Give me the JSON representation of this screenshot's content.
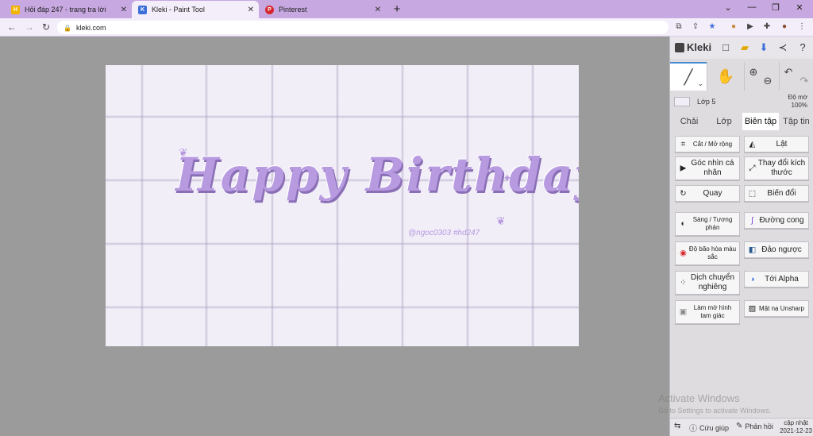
{
  "browser": {
    "tabs": [
      {
        "title": "Hỏi đáp 247 - trang tra lời",
        "favicon_color": "#f0b400"
      },
      {
        "title": "Kleki - Paint Tool",
        "favicon_color": "#3c6fd9"
      },
      {
        "title": "Pinterest",
        "favicon_color": "#d7262b"
      }
    ],
    "new_tab": "+",
    "url": "kleki.com",
    "accent": "#c7a8e0"
  },
  "canvas": {
    "text": "Happy Birthday",
    "watermark": "@ngoc0303   #hd247",
    "text_color": "#b79ae0",
    "background": "#f2eef8"
  },
  "panel": {
    "logo": "Kleki",
    "layer": {
      "name": "Lớp 5",
      "opacity_label": "Độ mờ",
      "opacity_value": "100%"
    },
    "tabs": [
      "Chải",
      "Lớp",
      "Biên tập",
      "Tập tin"
    ],
    "active_tab": "Biên tập",
    "buttons": [
      {
        "label": "Cắt / Mở rộng",
        "icon": "crop-icon"
      },
      {
        "label": "Lật",
        "icon": "flip-icon"
      },
      {
        "label": "Góc nhìn cá nhân",
        "icon": "perspective-icon"
      },
      {
        "label": "Thay đổi kích thước",
        "icon": "resize-icon"
      },
      {
        "label": "Quay",
        "icon": "rotate-icon"
      },
      {
        "label": "Biến đổi",
        "icon": "transform-icon"
      },
      {
        "label": "Sáng / Tương phản",
        "icon": "contrast-icon"
      },
      {
        "label": "Đường cong",
        "icon": "curves-icon"
      },
      {
        "label": "Độ bão hòa màu sắc",
        "icon": "saturation-icon"
      },
      {
        "label": "Đảo ngược",
        "icon": "invert-icon"
      },
      {
        "label": "Dịch chuyển nghiêng",
        "icon": "tilt-shift-icon"
      },
      {
        "label": "Tới Alpha",
        "icon": "to-alpha-icon"
      },
      {
        "label": "Làm mờ hình tam giác",
        "icon": "triangle-blur-icon"
      },
      {
        "label": "Mặt nạ Unsharp",
        "icon": "unsharp-mask-icon"
      }
    ],
    "footer": {
      "help": "Cứu giúp",
      "feedback": "Phản hồi",
      "update_label": "cập nhật",
      "update_date": "2021-12-23"
    }
  },
  "os": {
    "activate_title": "Activate Windows",
    "activate_sub": "Go to Settings to activate Windows."
  }
}
